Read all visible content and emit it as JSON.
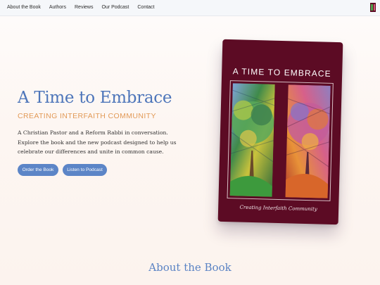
{
  "nav": {
    "links": [
      "About the Book",
      "Authors",
      "Reviews",
      "Our Podcast",
      "Contact"
    ],
    "thumbnail_icon": "book-cover-thumbnail"
  },
  "hero": {
    "title": "A Time to Embrace",
    "subtitle": "CREATING INTERFAITH COMMUNITY",
    "description": "A Christian Pastor and a Reform Rabbi in conversation. Explore the book and the new podcast designed to help us celebrate our differences and unite in common cause.",
    "buttons": {
      "order": "Order the Book",
      "podcast": "Listen to Podcast"
    }
  },
  "book": {
    "cover_title": "A TIME TO EMBRACE",
    "cover_subtitle": "Creating Interfaith Community",
    "cover_art": "stained-glass-trees",
    "cover_color": "#5c0b24"
  },
  "section": {
    "title": "About the Book"
  },
  "colors": {
    "accent_blue": "#4e76ba",
    "accent_orange": "#e29a57",
    "button_blue": "#5c85c7"
  }
}
